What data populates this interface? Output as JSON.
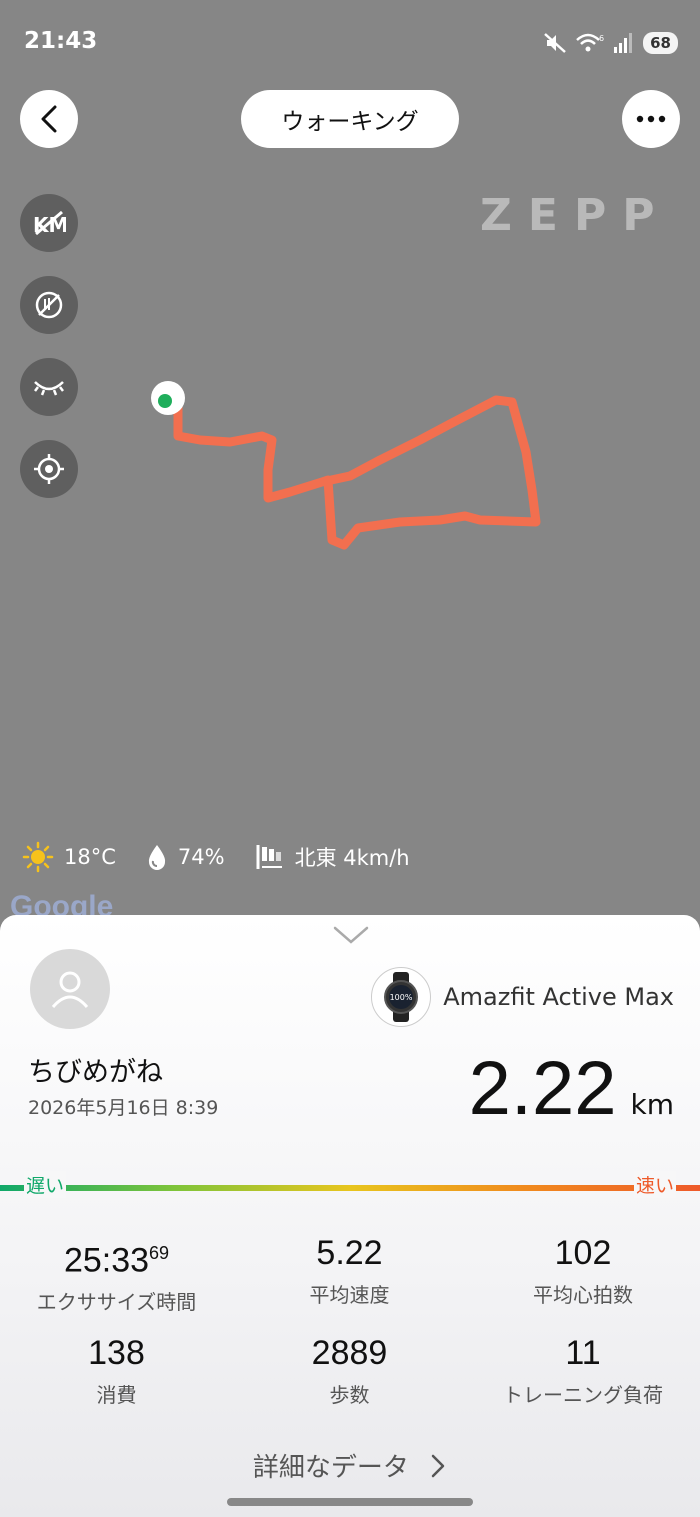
{
  "status_bar": {
    "time": "21:43",
    "battery": "68"
  },
  "header": {
    "title": "ウォーキング",
    "brand": "ZEPP"
  },
  "map_tools": [
    {
      "icon": "km-marker-off-icon"
    },
    {
      "icon": "no-pace-icon"
    },
    {
      "icon": "eye-closed-icon"
    },
    {
      "icon": "locate-icon"
    }
  ],
  "weather": {
    "temperature": "18°C",
    "humidity": "74%",
    "wind": "北東 4km/h"
  },
  "map_attribution": "Google",
  "colors": {
    "route": "#f26f4f",
    "start_marker": "#1fae5b",
    "slow": "#10a86a",
    "fast": "#ee5a2a"
  },
  "summary": {
    "user_name": "ちびめがね",
    "date": "2026年5月16日 8:39",
    "device": "Amazfit Active Max",
    "device_screen_text": "100%",
    "distance_value": "2.22",
    "distance_unit": "km",
    "pace_slow": "遅い",
    "pace_fast": "速い"
  },
  "stats": [
    {
      "value": "25:33",
      "sup": "69",
      "label": "エクササイズ時間"
    },
    {
      "value": "5.22",
      "sup": "",
      "label": "平均速度"
    },
    {
      "value": "102",
      "sup": "",
      "label": "平均心拍数"
    },
    {
      "value": "138",
      "sup": "",
      "label": "消費"
    },
    {
      "value": "2889",
      "sup": "",
      "label": "歩数"
    },
    {
      "value": "11",
      "sup": "",
      "label": "トレーニング負荷"
    }
  ],
  "more_data_label": "詳細なデータ"
}
